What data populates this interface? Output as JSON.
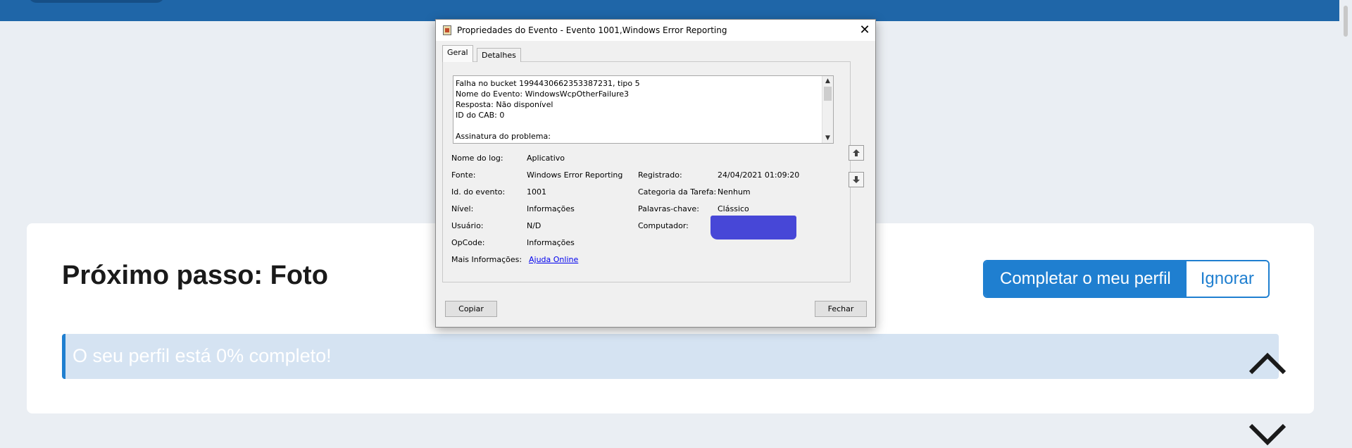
{
  "page": {
    "card_title": "Próximo passo: Foto",
    "complete_profile_button": "Completar o meu perfil",
    "ignore_button": "Ignorar",
    "progress_text": "O seu perfil está 0% completo!",
    "accent_color": "#1f7fd0",
    "header_color": "#1f66a8"
  },
  "dialog": {
    "title": "Propriedades do Evento - Evento 1001,Windows Error Reporting",
    "tabs": [
      "Geral",
      "Detalhes"
    ],
    "description_lines": [
      "Falha no bucket 1994430662353387231, tipo 5",
      "Nome do Evento: WindowsWcpOtherFailure3",
      "Resposta: Não disponível",
      "ID do CAB: 0",
      "",
      "Assinatura do problema:"
    ],
    "fields": {
      "log_name_label": "Nome do log:",
      "log_name_value": "Aplicativo",
      "source_label": "Fonte:",
      "source_value": "Windows Error Reporting",
      "event_id_label": "Id. do evento:",
      "event_id_value": "1001",
      "level_label": "Nível:",
      "level_value": "Informações",
      "user_label": "Usuário:",
      "user_value": "N/D",
      "opcode_label": "OpCode:",
      "opcode_value": "Informações",
      "more_info_label": "Mais Informações:",
      "more_info_link": "Ajuda Online",
      "logged_label": "Registrado:",
      "logged_value": "24/04/2021 01:09:20",
      "task_category_label": "Categoria da Tarefa:",
      "task_category_value": "Nenhum",
      "keywords_label": "Palavras-chave:",
      "keywords_value": "Clássico",
      "computer_label": "Computador:"
    },
    "copy_button": "Copiar",
    "close_button": "Fechar",
    "redaction_color": "#4747d7"
  }
}
